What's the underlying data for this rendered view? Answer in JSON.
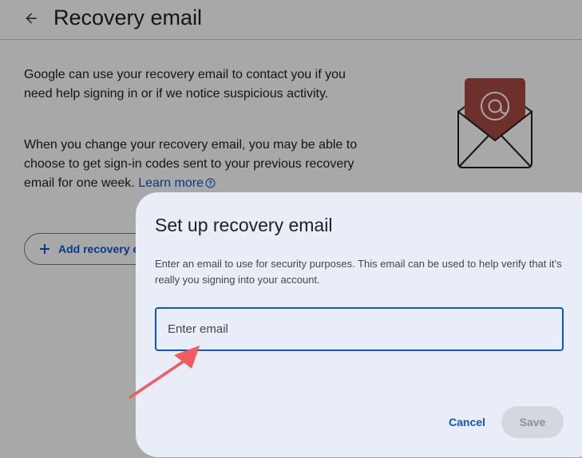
{
  "header": {
    "title": "Recovery email",
    "back_icon": "arrow-back-icon"
  },
  "content": {
    "paragraph_1": "Google can use your recovery email to contact you if you need help signing in or if we notice suspicious activity.",
    "paragraph_2": "When you change your recovery email, you may be able to choose to get sign-in codes sent to your previous recovery email for one week.",
    "learn_more_label": "Learn more",
    "add_button_label": "Add recovery email"
  },
  "illustration": {
    "icon": "envelope-at-icon",
    "card_color": "#a84a42"
  },
  "dialog": {
    "title": "Set up recovery email",
    "description": "Enter an email to use for security purposes. This email can be used to help verify that it’s really you signing into your account.",
    "input_placeholder": "Enter email",
    "input_value": "",
    "cancel_label": "Cancel",
    "save_label": "Save"
  },
  "colors": {
    "accent": "#0b57d0",
    "dialog_background": "#e8edf7",
    "annotation_arrow": "#f25c5c"
  }
}
